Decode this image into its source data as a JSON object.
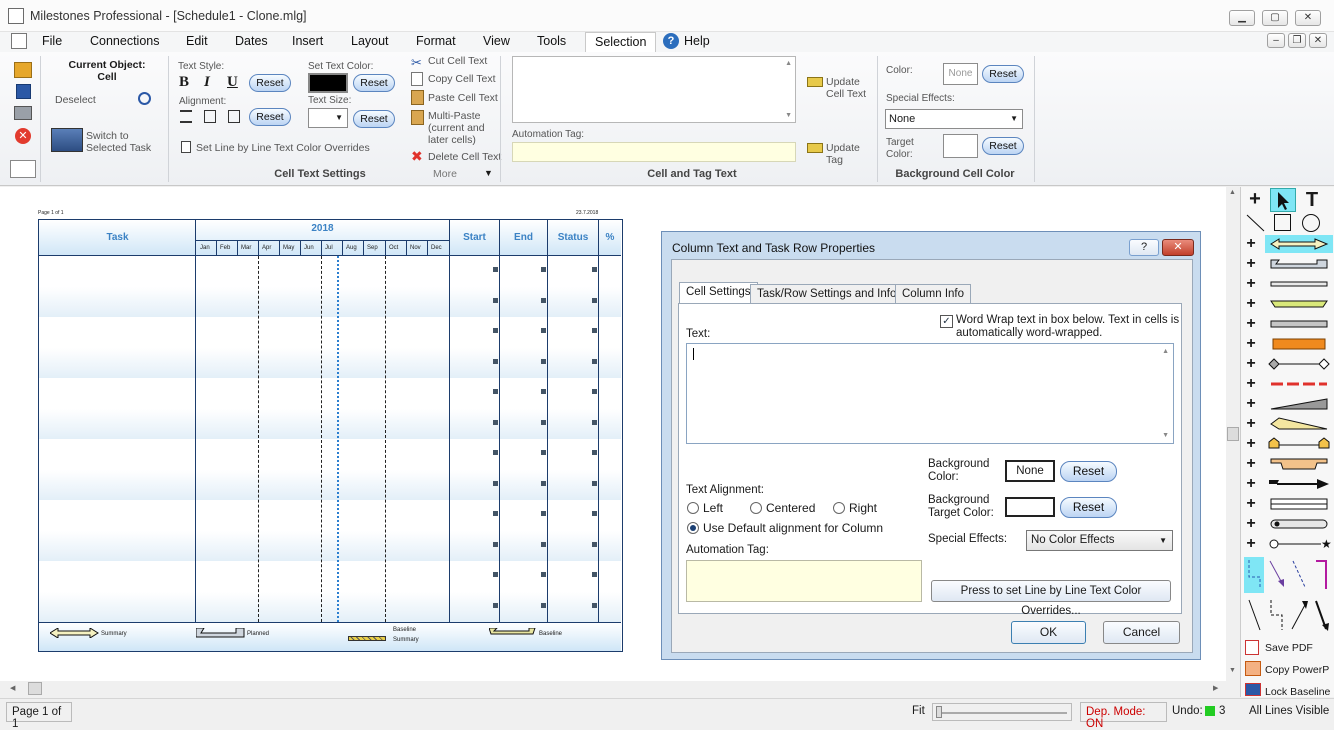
{
  "window": {
    "title": "Milestones Professional - [Schedule1 - Clone.mlg]"
  },
  "menu": [
    {
      "label": "File"
    },
    {
      "label": "Connections"
    },
    {
      "label": "Edit"
    },
    {
      "label": "Dates"
    },
    {
      "label": "Insert"
    },
    {
      "label": "Layout"
    },
    {
      "label": "Format"
    },
    {
      "label": "View"
    },
    {
      "label": "Tools"
    },
    {
      "label": "Selection"
    },
    {
      "label": "Help"
    }
  ],
  "ribbon": {
    "current_object_label": "Current Object:",
    "current_object_value": "Cell",
    "deselect": "Deselect",
    "switch_to": "Switch to",
    "selected_task": "Selected Task",
    "text_style_label": "Text Style:",
    "bold": "B",
    "italic": "I",
    "underline": "U",
    "reset": "Reset",
    "set_text_color_label": "Set Text Color:",
    "alignment_label": "Alignment:",
    "text_size_label": "Text Size:",
    "set_line_overrides": "Set Line by Line Text Color Overrides",
    "cut_cell_text": "Cut Cell Text",
    "copy_cell_text": "Copy Cell Text",
    "paste_cell_text": "Paste Cell Text",
    "multi_paste_1": "Multi-Paste",
    "multi_paste_2": "(current and",
    "multi_paste_3": "later cells)",
    "delete_cell_text": "Delete Cell Text",
    "more": "More",
    "group_cell_text_settings": "Cell Text Settings",
    "automation_tag_label": "Automation Tag:",
    "update_cell_text_1": "Update",
    "update_cell_text_2": "Cell Text",
    "update_tag_1": "Update",
    "update_tag_2": "Tag",
    "group_cell_and_tag": "Cell and Tag Text",
    "color_label": "Color:",
    "color_value": "None",
    "special_effects_label": "Special Effects:",
    "special_effects_value": "None",
    "target_color_1": "Target",
    "target_color_2": "Color:",
    "group_bg_cell_color": "Background Cell Color"
  },
  "schedule": {
    "page_label": "Page 1 of 1",
    "date": "23.7.2018",
    "col_task": "Task",
    "year": "2018",
    "months": [
      "Jan",
      "Feb",
      "Mar",
      "Apr",
      "May",
      "Jun",
      "Jul",
      "Aug",
      "Sep",
      "Oct",
      "Nov",
      "Dec"
    ],
    "col_start": "Start",
    "col_end": "End",
    "col_status": "Status",
    "col_pct": "%",
    "legend": {
      "summary": "Summary",
      "planned": "Planned",
      "baseline_summary_1": "Baseline",
      "baseline_summary_2": "Summary",
      "baseline": "Baseline"
    }
  },
  "dialog": {
    "title": "Column Text and Task Row Properties",
    "help": "?",
    "tabs": [
      "Cell Settings",
      "Task/Row Settings and Info",
      "Column Info"
    ],
    "word_wrap_1": "Word Wrap text in box below. Text in cells is",
    "word_wrap_2": "automatically word-wrapped.",
    "text_label": "Text:",
    "bg_color_1": "Background",
    "bg_color_2": "Color:",
    "bg_color_value": "None",
    "reset": "Reset",
    "bg_target_1": "Background",
    "bg_target_2": "Target Color:",
    "text_alignment_label": "Text Alignment:",
    "align_left": "Left",
    "align_centered": "Centered",
    "align_right": "Right",
    "use_default": "Use Default alignment for Column",
    "special_effects_label": "Special Effects:",
    "special_effects_value": "No Color Effects",
    "automation_tag_label": "Automation Tag:",
    "line_overrides_button": "Press to set Line by Line Text Color Overrides...",
    "ok": "OK",
    "cancel": "Cancel"
  },
  "toolbox": {
    "save_pdf": "Save PDF",
    "copy_powerpoint": "Copy PowerP",
    "lock_baseline": "Lock Baseline"
  },
  "status": {
    "page": "Page 1 of 1",
    "fit": "Fit",
    "dep_mode": "Dep. Mode: ON",
    "undo_label": "Undo:",
    "undo_count": "3",
    "lines": "All Lines Visible"
  },
  "colors": {
    "accent": "#3b82c4",
    "dep_mode": "#cc0000",
    "undo_indicator": "#22cc22"
  }
}
